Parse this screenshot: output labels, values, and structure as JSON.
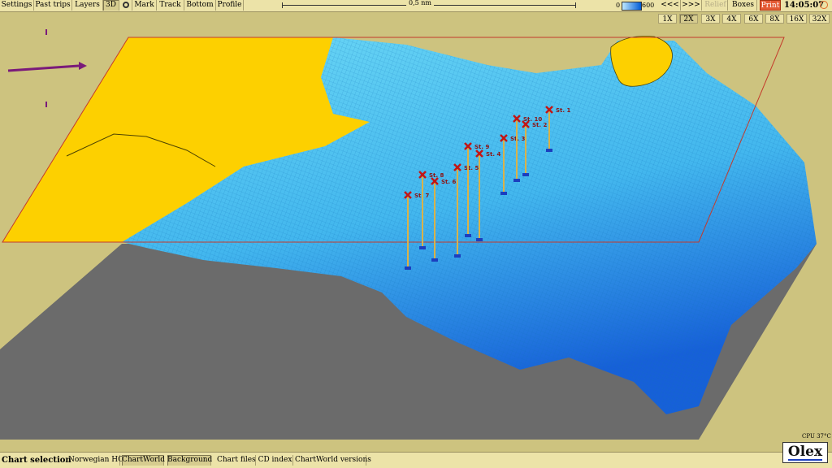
{
  "toolbar": {
    "settings": "Settings",
    "past_trips": "Past trips",
    "layers": "Layers",
    "three_d": "3D",
    "mark": "Mark",
    "track": "Track",
    "bottom": "Bottom",
    "profile": "Profile",
    "scale_label": "0,5 nm",
    "depth_min": "0",
    "depth_max": "600",
    "prev": "<<<",
    "next": ">>>",
    "relief": "Relief",
    "boxes": "Boxes",
    "print": "Print",
    "time": "14:05:07"
  },
  "zoom": [
    "1X",
    "2X",
    "3X",
    "4X",
    "6X",
    "8X",
    "16X",
    "32X"
  ],
  "zoom_selected": "2X",
  "stations": [
    "St. 1",
    "St. 2",
    "St. 3",
    "St. 4",
    "St. 5",
    "St. 6",
    "St. 7",
    "St. 8",
    "St. 9",
    "St. 10"
  ],
  "bottom": {
    "chart_selection": "Chart selection",
    "norwegian_ho": "Norwegian HO",
    "chartworld": "ChartWorld",
    "background": "Background",
    "chart_files": "Chart files",
    "cd_index": "CD index",
    "chartworld_versions": "ChartWorld versions"
  },
  "cpu": "CPU 37°C",
  "brand": "Olex",
  "colors": {
    "land": "#fdd000",
    "sea_light": "#56cdf0",
    "sea_deep": "#1c6fe0",
    "base": "#6b6b6b",
    "frame": "#cdc37f",
    "marker": "#c21515"
  }
}
